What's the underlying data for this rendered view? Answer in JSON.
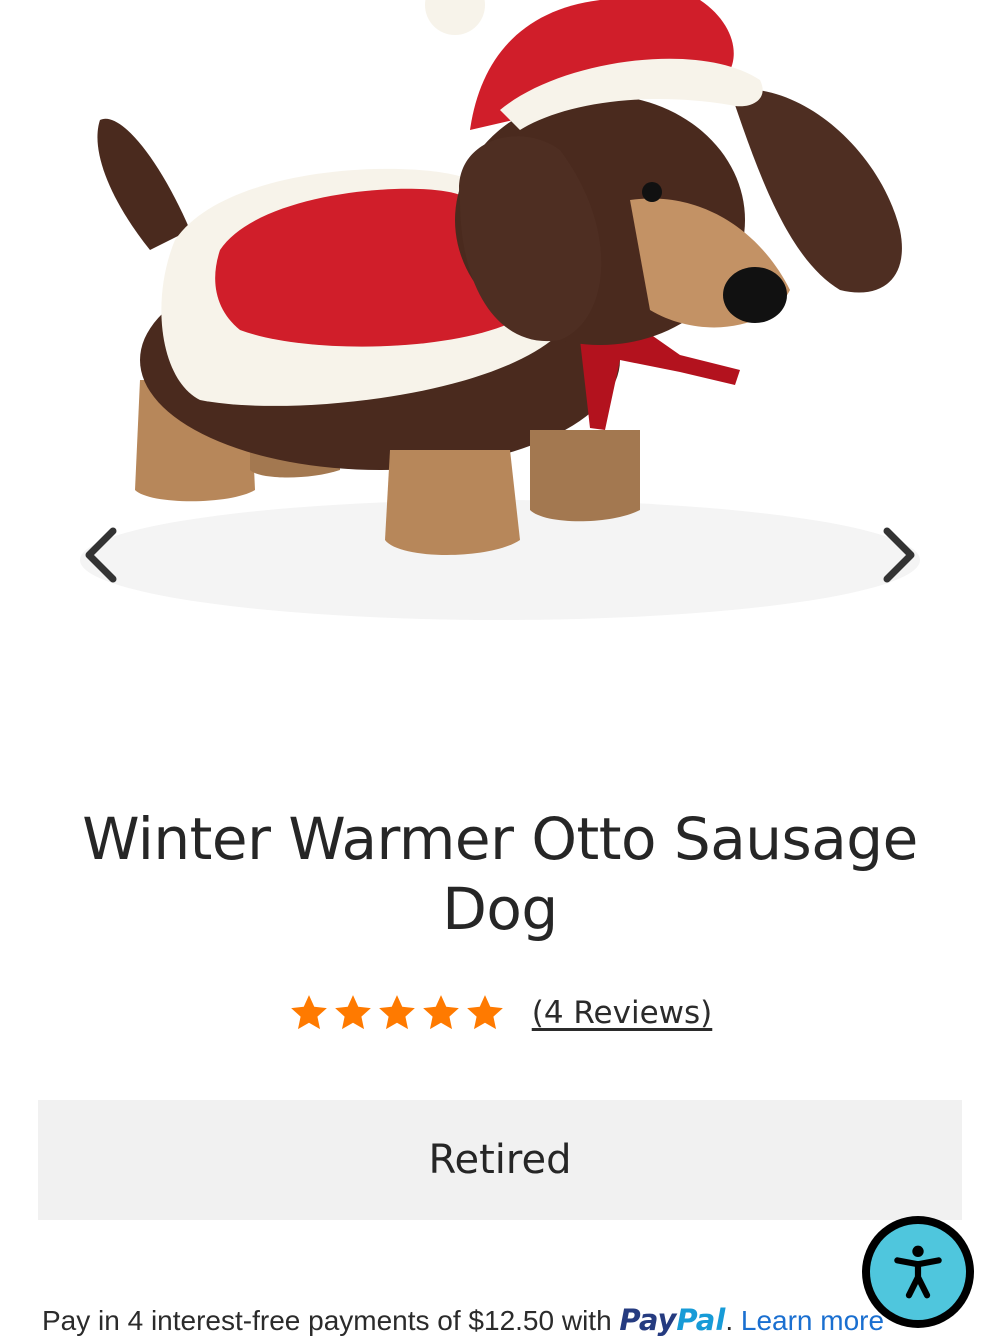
{
  "product": {
    "title": "Winter Warmer Otto Sausage Dog",
    "rating_value": 5,
    "rating_max": 5,
    "reviews_label": "(4 Reviews)",
    "status_label": "Retired"
  },
  "colors": {
    "star": "#ff7a00",
    "status_bg": "#f1f1f1",
    "paypal_dark": "#253b80",
    "paypal_light": "#179bd7",
    "link": "#1a6fd0",
    "accessibility": "#4fc6dd"
  },
  "gallery": {
    "prev_icon": "chevron-left-icon",
    "next_icon": "chevron-right-icon"
  },
  "paypal": {
    "text": "Pay in 4 interest-free payments of $12.50 with",
    "logo_pay": "Pay",
    "logo_pal": "Pal",
    "separator": ".",
    "learn_more": "Learn more"
  },
  "accessibility": {
    "icon": "accessibility-person-icon"
  }
}
